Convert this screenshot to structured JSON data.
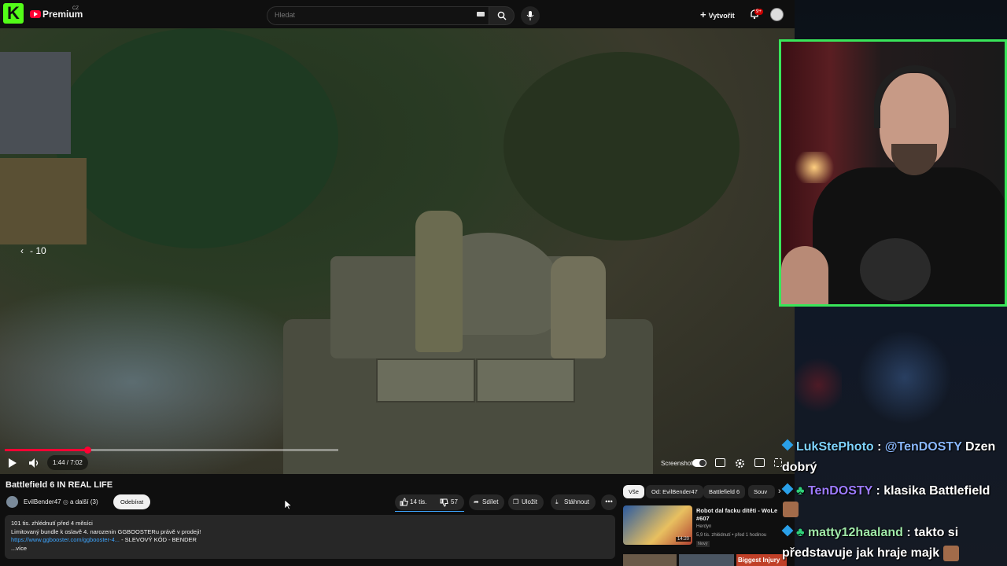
{
  "header": {
    "site_logo_letter": "K",
    "app_name": "Premium",
    "region": "CZ",
    "search_placeholder": "Hledat",
    "create_label": "Vytvořit",
    "notifications_badge": "9+"
  },
  "player": {
    "skip_back_label": "- 10",
    "time_display": "1:44 / 7:02",
    "progress": 0.247,
    "screenshot_label": "Screenshot"
  },
  "video": {
    "title": "Battlefield 6 IN REAL LIFE",
    "channel": "EvilBender47",
    "collab": "a  další (3)",
    "subscribe_label": "Odebírat",
    "likes": "14 tis.",
    "dislikes": "57",
    "share_label": "Sdílet",
    "save_label": "Uložit",
    "download_label": "Stáhnout",
    "more_label": "•••"
  },
  "description": {
    "stats": "101 tis. zhlédnutí  před 4 měsíci",
    "line1": "Limitovaný bundle k oslavě 4. narozenin GGBOOSTERu právě v prodeji!",
    "link": "https://www.ggbooster.com/ggbooster-4...",
    "link_suffix": " - SLEVOVÝ KÓD - BENDER",
    "more": "...více"
  },
  "recommendations": {
    "chips": [
      "Vše",
      "Od: EvilBender47",
      "Battlefield 6",
      "Souv"
    ],
    "item": {
      "title": "Robot dal facku dítěti - WoLe #607",
      "channel": "Herdyn",
      "meta": "5,9 tis. zhlédnutí • před 1 hodinou",
      "badge": "Nový",
      "duration": "14:20"
    },
    "next_tag": "Biggest Injury"
  },
  "chat": [
    {
      "user": "LukStePhoto",
      "mention": "@TenDOSTY",
      "text": " Dzen dobrý"
    },
    {
      "user": "TenDOSTY",
      "mention": "",
      "text": " klasika Battlefield"
    },
    {
      "user": "matty12haaland",
      "mention": "",
      "text": " takto si představuje jak hraje majk"
    }
  ],
  "colors": {
    "accent_red": "#ff0033",
    "kick_green": "#53fc18",
    "webcam_border": "#39e65a",
    "link_blue": "#3ea6ff"
  }
}
